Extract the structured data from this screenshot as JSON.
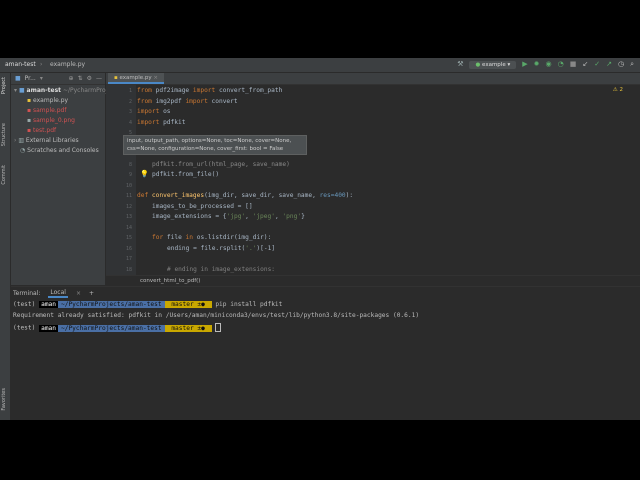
{
  "nav": {
    "project": "aman-test",
    "file": "example.py",
    "run_config": "example"
  },
  "tool_windows": {
    "project": "Project",
    "structure": "Structure",
    "commit": "Commit",
    "favorites": "Favorites"
  },
  "project_panel": {
    "title": "Pr...",
    "root_name": "aman-test",
    "root_path": "~/PycharmProjects",
    "files": [
      "example.py",
      "sample.pdf",
      "sample_0.png",
      "test.pdf"
    ],
    "external": "External Libraries",
    "scratches": "Scratches and Consoles"
  },
  "editor": {
    "tab": "example.py",
    "warn_count": "2",
    "line_numbers": [
      "1",
      "2",
      "3",
      "4",
      "5",
      "6",
      "7",
      "8",
      "9",
      "10",
      "11",
      "12",
      "13",
      "14",
      "15",
      "16",
      "17",
      "18",
      "19"
    ],
    "lines": {
      "l1_kw1": "from",
      "l1_mod": " pdf2image ",
      "l1_kw2": "import",
      "l1_name": " convert_from_path",
      "l2_kw1": "from",
      "l2_mod": " img2pdf ",
      "l2_kw2": "import",
      "l2_name": " convert",
      "l3_kw": "import",
      "l3_name": " os",
      "l4_kw": "import",
      "l4_name": " pdfkit",
      "l8": "pdfkit.from_url(html_page, save_name)",
      "l9": "pdfkit.from_file()",
      "l11_kw": "def",
      "l11_fn": " convert_images",
      "l11_rest": "(img_dir, save_dir, save_name, ",
      "l11_res": "res=400",
      "l11_end": "):",
      "l12": "images_to_be_processed = []",
      "l13_a": "image_extensions = {",
      "l13_s1": "'jpg'",
      "l13_c1": ", ",
      "l13_s2": "'jpeg'",
      "l13_c2": ", ",
      "l13_s3": "'png'",
      "l13_end": "}",
      "l15_kw": "for",
      "l15_rest": " file ",
      "l15_kw2": "in",
      "l15_rest2": " os.listdir(img_dir):",
      "l16_a": "ending = file.rsplit(",
      "l16_s": "'.'",
      "l16_b": ")[-1]",
      "l18": "# ending in image_extensions:"
    },
    "tooltip_line1": "input, output_path, options=None, toc=None, cover=None,",
    "tooltip_line2": "css=None, configuration=None, cover_first: bool = False",
    "breadcrumb": "convert_html_to_pdf()"
  },
  "terminal": {
    "label": "Terminal:",
    "tab": "Local",
    "add": "+",
    "env": "(test)",
    "user": "aman",
    "path": "~/PycharmProjects/aman-test",
    "git": " master ±● ",
    "command": "pip install pdfkit",
    "output": "Requirement already satisfied: pdfkit in /Users/aman/miniconda3/envs/test/lib/python3.8/site-packages (0.6.1)"
  },
  "colors": {
    "background": "#2b2b2b",
    "panel": "#3c3f41",
    "keyword": "#cc7832",
    "function": "#ffc66d",
    "string": "#6a8759",
    "path_segment": "#4a6fa5",
    "git_segment": "#c9a800"
  }
}
